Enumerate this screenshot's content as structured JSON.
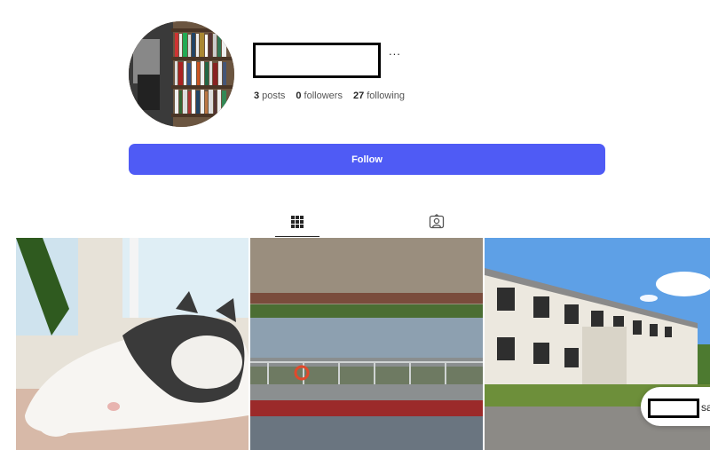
{
  "profile": {
    "more_label": "...",
    "stats": {
      "posts_count": "3",
      "posts_label": "posts",
      "followers_count": "0",
      "followers_label": "followers",
      "following_count": "27",
      "following_label": "following"
    },
    "follow_label": "Follow"
  },
  "tabs": [
    {
      "icon": "grid-icon",
      "active": true
    },
    {
      "icon": "tagged-user-icon",
      "active": false
    }
  ],
  "posts": [
    {
      "subject": "sleeping-cat-photo"
    },
    {
      "subject": "river-barge-photo"
    },
    {
      "subject": "abandoned-building-photo"
    }
  ],
  "toast": {
    "text": "sa"
  },
  "colors": {
    "accent": "#4f5bf5",
    "text": "#262626",
    "muted": "#555555"
  }
}
